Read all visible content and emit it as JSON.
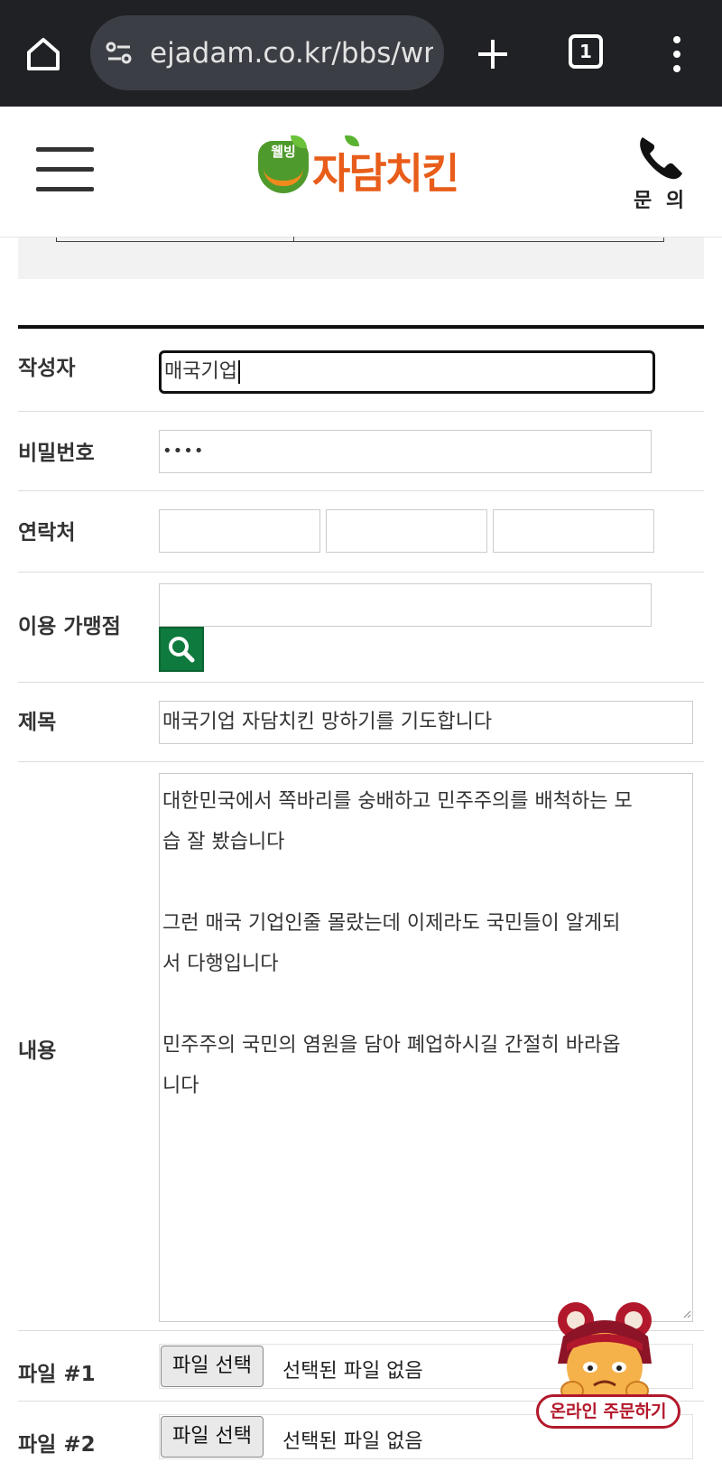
{
  "browser": {
    "url": "ejadam.co.kr/bbs/wr",
    "tab_count": "1"
  },
  "site": {
    "logo_badge": "웰빙",
    "logo_name": "자담치킨",
    "phone_label": "문 의"
  },
  "form": {
    "author_label": "작성자",
    "author_value": "매국기업",
    "password_label": "비밀번호",
    "password_value": "••••",
    "contact_label": "연락처",
    "contact_values": [
      "",
      "",
      ""
    ],
    "store_label": "이용 가맹점",
    "store_value": "",
    "subject_label": "제목",
    "subject_value": "매국기업 자담치킨 망하기를 기도합니다",
    "content_label": "내용",
    "content_value": "대한민국에서 쪽바리를 숭배하고 민주주의를 배척하는 모\n습 잘 봤습니다\n\n그런 매국 기업인줄 몰랐는데 이제라도 국민들이 알게되\n서 다행입니다\n\n민주주의 국민의 염원을 담아 폐업하시길 간절히 바라옵\n니다",
    "file1_label": "파일 #1",
    "file2_label": "파일 #2",
    "file_button": "파일 선택",
    "file_status": "선택된 파일 없음"
  },
  "floating": {
    "order_label": "온라인 주문하기"
  },
  "colors": {
    "chrome_bg": "#1f2124",
    "brand_orange": "#e85d1a",
    "brand_green": "#4f9a2c",
    "search_green": "#0e7a3d",
    "order_red": "#b2182b"
  }
}
